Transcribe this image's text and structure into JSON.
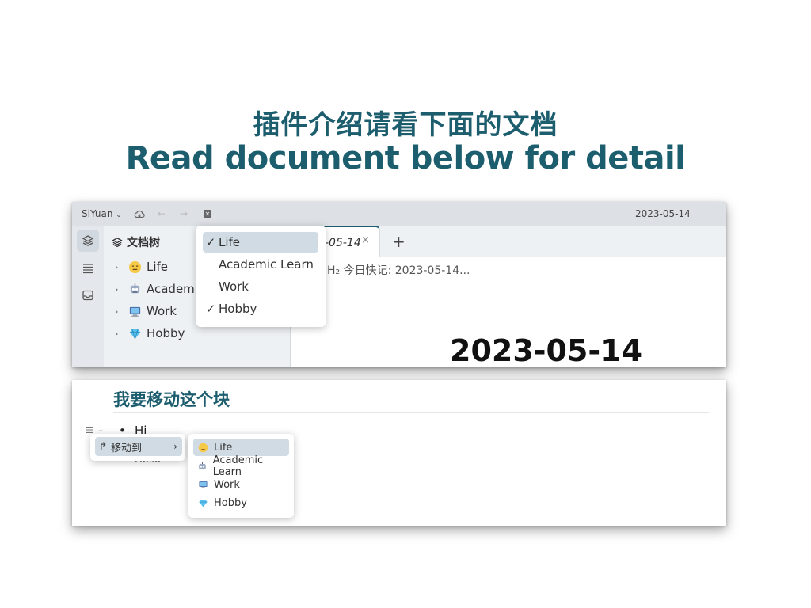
{
  "headline": {
    "cn": "插件介绍请看下面的文档",
    "en": "Read document below for detail"
  },
  "panel1": {
    "app_name": "SiYuan",
    "topbar_date": "2023-05-14",
    "tree_header": "文档树",
    "tree_items": [
      {
        "label": "Life",
        "icon": "expressionless-face-icon"
      },
      {
        "label": "Academic",
        "icon": "robot-icon"
      },
      {
        "label": "Work",
        "icon": "computer-icon"
      },
      {
        "label": "Hobby",
        "icon": "gem-icon"
      }
    ],
    "tab_label": "-05-14",
    "tab_close": "×",
    "tab_add": "+",
    "breadcrumb": "H₂ 今日快记: 2023-05-14...",
    "doc_title": "2023-05-14",
    "filter_menu": [
      {
        "label": "Life",
        "checked": true,
        "selected": true
      },
      {
        "label": "Academic Learn",
        "checked": false,
        "selected": false
      },
      {
        "label": "Work",
        "checked": false,
        "selected": false
      },
      {
        "label": "Hobby",
        "checked": true,
        "selected": false
      }
    ]
  },
  "panel2": {
    "heading": "我要移动这个块",
    "bullet_text": "Hi",
    "sub_text": "Hello",
    "context_item": "移动到",
    "submenu": [
      {
        "label": "Life",
        "icon": "expressionless-face-icon",
        "selected": true
      },
      {
        "label": "Academic Learn",
        "icon": "robot-icon",
        "selected": false
      },
      {
        "label": "Work",
        "icon": "computer-icon",
        "selected": false
      },
      {
        "label": "Hobby",
        "icon": "gem-icon",
        "selected": false
      }
    ]
  },
  "colors": {
    "accent": "#1c5d6e",
    "selection": "#d0dbe3",
    "sidebar_bg": "#eef1f4",
    "topbar_bg": "#dde1e6"
  }
}
